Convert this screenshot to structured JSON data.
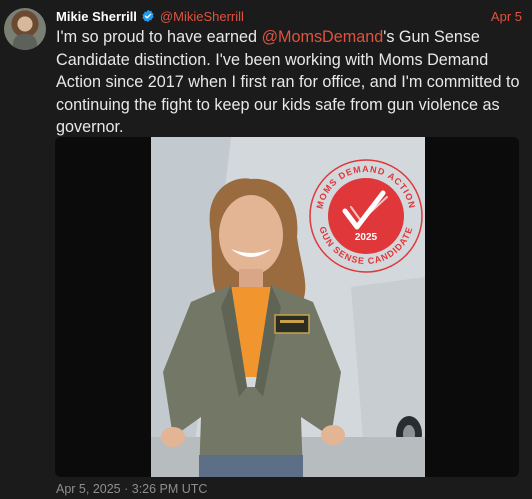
{
  "tweet": {
    "author_name": "Mikie Sherrill",
    "author_handle": "@MikieSherrill",
    "date_short": "Apr 5",
    "text_before_mention": "I'm so proud to have earned ",
    "mention": "@MomsDemand",
    "text_after_mention": "'s Gun Sense Candidate distinction. I've been working with Moms Demand Action since 2017 when I first ran for office, and I'm committed to continuing the fight to keep our kids safe from gun violence as governor.",
    "timestamp": "Apr 5, 2025 · 3:26 PM UTC"
  },
  "badge": {
    "top_text": "MOMS DEMAND ACTION",
    "bottom_text": "GUN SENSE CANDIDATE",
    "year": "2025"
  },
  "colors": {
    "accent": "#e0533f",
    "verified": "#1d9bf0",
    "badge_red": "#e0373a",
    "background": "#1b1b1b"
  },
  "icons": {
    "verified": "verified-badge-icon"
  }
}
